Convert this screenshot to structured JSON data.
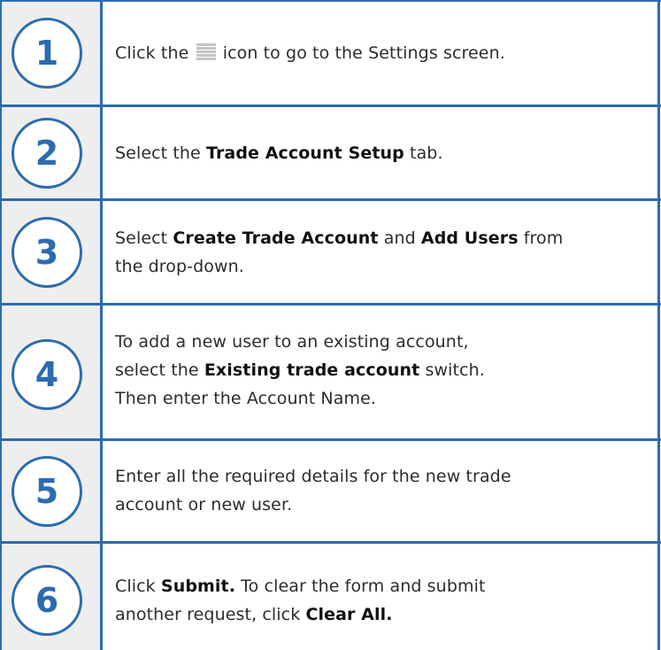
{
  "steps": [
    {
      "number": "1",
      "parts": [
        {
          "t": "Click the",
          "b": false
        },
        {
          "icon": "menu-icon"
        },
        {
          "t": "icon to go to the Settings screen.",
          "b": false
        }
      ]
    },
    {
      "number": "2",
      "parts": [
        {
          "t": "Select the ",
          "b": false
        },
        {
          "t": "Trade Account Setup",
          "b": true
        },
        {
          "t": " tab.",
          "b": false
        }
      ]
    },
    {
      "number": "3",
      "parts": [
        {
          "t": "Select ",
          "b": false
        },
        {
          "t": "Create Trade Account",
          "b": true
        },
        {
          "t": " and ",
          "b": false
        },
        {
          "t": "Add Users",
          "b": true
        },
        {
          "t": " from",
          "b": false
        },
        {
          "br": true
        },
        {
          "t": "the drop-down.",
          "b": false
        }
      ]
    },
    {
      "number": "4",
      "parts": [
        {
          "t": "To add a new user to an existing account,",
          "b": false
        },
        {
          "br": true
        },
        {
          "t": "select the ",
          "b": false
        },
        {
          "t": "Existing trade account",
          "b": true
        },
        {
          "t": " switch.",
          "b": false
        },
        {
          "br": true
        },
        {
          "t": "Then enter the Account Name.",
          "b": false
        }
      ]
    },
    {
      "number": "5",
      "parts": [
        {
          "t": "Enter all the required details for the new trade",
          "b": false
        },
        {
          "br": true
        },
        {
          "t": "account or new user.",
          "b": false
        }
      ]
    },
    {
      "number": "6",
      "parts": [
        {
          "t": "Click ",
          "b": false
        },
        {
          "t": "Submit.",
          "b": true
        },
        {
          "t": " To clear the form and submit",
          "b": false
        },
        {
          "br": true
        },
        {
          "t": "another request, click ",
          "b": false
        },
        {
          "t": "Clear All.",
          "b": true
        }
      ]
    }
  ],
  "colors": {
    "accent": "#2b6cb0",
    "number_column_bg": "#eeeeee",
    "text": "#2c2c2c"
  }
}
